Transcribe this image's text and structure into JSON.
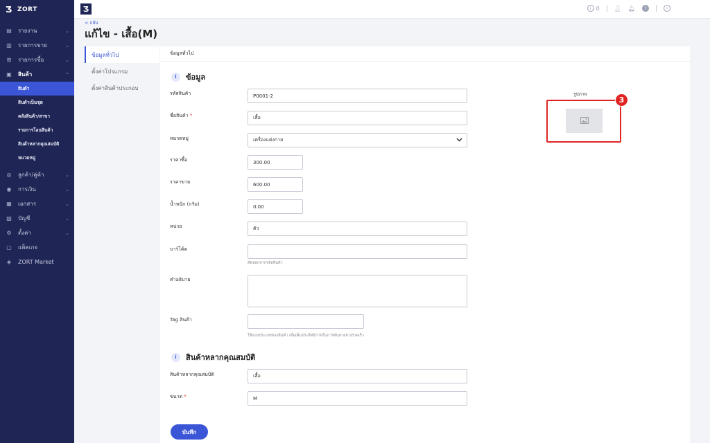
{
  "brand": {
    "name": "ZORT"
  },
  "sidebar": {
    "items": [
      {
        "label": "รายงาน",
        "icon": "chart-icon",
        "chevron": "⌄"
      },
      {
        "label": "รายการขาย",
        "icon": "clipboard-icon",
        "chevron": "⌄"
      },
      {
        "label": "รายการซื้อ",
        "icon": "cart-icon",
        "chevron": "⌄"
      },
      {
        "label": "สินค้า",
        "icon": "box-icon",
        "chevron": "⌃"
      }
    ],
    "sub_items": [
      {
        "label": "สินค้า"
      },
      {
        "label": "สินค้าเป็นชุด"
      },
      {
        "label": "คลังสินค้า/สาขา"
      },
      {
        "label": "รายการโอนสินค้า"
      },
      {
        "label": "สินค้าหลากคุณสมบัติ"
      },
      {
        "label": "หมวดหมู่"
      }
    ],
    "items2": [
      {
        "label": "ลูกค้า/คู่ค้า",
        "icon": "handshake-icon",
        "chevron": "⌄"
      },
      {
        "label": "การเงิน",
        "icon": "money-icon",
        "chevron": "⌄"
      },
      {
        "label": "เอกสาร",
        "icon": "document-icon",
        "chevron": "⌄"
      },
      {
        "label": "บัญชี",
        "icon": "ledger-icon",
        "chevron": "⌄"
      },
      {
        "label": "ตั้งค่า",
        "icon": "gear-icon",
        "chevron": "⌄"
      },
      {
        "label": "แพ็คเกจ",
        "icon": "package-icon"
      },
      {
        "label": "ZORT Market",
        "icon": "market-icon"
      }
    ]
  },
  "topbar": {
    "info_count": "0"
  },
  "header": {
    "back_label": "< กลับ",
    "title": "แก้ไข - เสื้อ(M)"
  },
  "tabs": [
    {
      "label": "ข้อมูลทั่วไป"
    },
    {
      "label": "ตั้งค่าโปรแกรม"
    },
    {
      "label": "ตั้งค่าสินค้าประกอบ"
    }
  ],
  "card": {
    "heading": "ข้อมูลทั่วไป",
    "section1": "ข้อมูล",
    "section2": "สินค้าหลากคุณสมบัติ",
    "image_label": "รูปภาพ",
    "badge": "3",
    "save_label": "บันทึก"
  },
  "fields": {
    "code": {
      "label": "รหัสสินค้า",
      "value": "P0001-2"
    },
    "name": {
      "label": "ชื่อสินค้า",
      "required": "*",
      "value": "เสื้อ"
    },
    "category": {
      "label": "หมวดหมู่",
      "value": "เครื่องแต่งกาย"
    },
    "cost": {
      "label": "ราคาซื้อ",
      "value": "300.00"
    },
    "price": {
      "label": "ราคาขาย",
      "value": "600.00"
    },
    "weight": {
      "label": "น้ำหนัก (กรัม)",
      "value": "0.00"
    },
    "unit": {
      "label": "หน่วย",
      "value": "ตัว"
    },
    "barcode": {
      "label": "บาร์โค้ด",
      "value": "",
      "help": "คัดลอกจากรหัสสินค้า"
    },
    "description": {
      "label": "คำอธิบาย",
      "value": ""
    },
    "tag": {
      "label": "Tag สินค้า",
      "value": "",
      "help": "ใช้แบ่งประเภทของสินค้า เพื่อเพิ่มประสิทธิภาพในการค้นหาอย่างรวดเร็ว"
    },
    "variant": {
      "label": "สินค้าหลากคุณสมบัติ",
      "value": "เสื้อ"
    },
    "size": {
      "label": "ขนาด",
      "required": "*",
      "value": "M"
    }
  },
  "colors": {
    "sidebar": "#1f2554",
    "accent": "#3a55d6",
    "highlight": "#e02424"
  }
}
